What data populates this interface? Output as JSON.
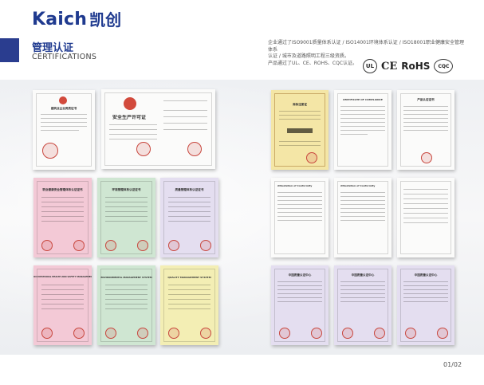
{
  "brand": {
    "name_en": "Kaich",
    "name_cn": "凯创"
  },
  "section": {
    "title": "管理认证",
    "subtitle": "CERTIFICATIONS"
  },
  "intro": {
    "line1": "企业通过了ISO9001质量体系认证 / ISO14001环境体系认证 / ISO18001职业健康安全管理体系",
    "line2": "认证 / 城市及道路照明工程三级资质。",
    "line3": "产品通过了UL、CE、ROHS、CQC认证。"
  },
  "logos": {
    "ul": "UL",
    "ce": "CE",
    "rohs": "RoHS",
    "cqc": "CQC"
  },
  "certificates": {
    "license_small": {
      "title": "建筑业企业资质证书"
    },
    "license_large": {
      "title": "安全生产许可证"
    },
    "pink1": {
      "title": "职业健康安全管理体系认证证书"
    },
    "green1": {
      "title": "环境管理体系认证证书"
    },
    "lilac1": {
      "title": "质量管理体系认证证书"
    },
    "pink2": {
      "title": "OCCUPATIONAL HEALTH AND SAFETY MANAGEMENT SYSTEM"
    },
    "green2": {
      "title": "ENVIRONMENTAL MANAGEMENT SYSTEM"
    },
    "yellow1": {
      "title": "QUALITY MANAGEMENT SYSTEM"
    },
    "trademark": {
      "title": "商标注册证"
    },
    "ul_cert": {
      "title": "CERTIFICATE OF COMPLIANCE"
    },
    "cqc1": {
      "title": "产品认证证书"
    },
    "ce1": {
      "title": "Attestation of Conformity"
    },
    "ce2": {
      "title": "Attestation of Conformity"
    },
    "ce3": {
      "title": ""
    },
    "cqc2": {
      "title": "中国质量认证中心"
    },
    "cqc3": {
      "title": "中国质量认证中心"
    },
    "cqc4": {
      "title": "中国质量认证中心"
    }
  },
  "page_number": "01/02"
}
